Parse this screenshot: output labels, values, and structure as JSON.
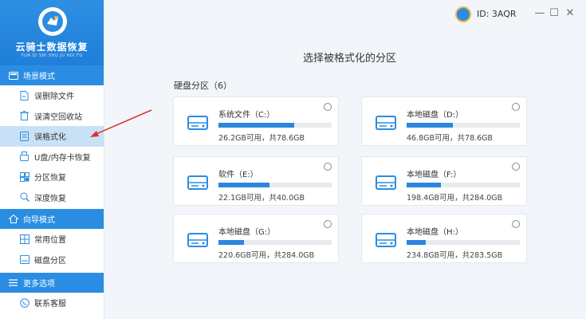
{
  "app": {
    "name": "云骑士数据恢复",
    "subtitle": "YUN QI SHI SHU JU HUI FU"
  },
  "titlebar": {
    "user_id": "ID: 3AQR",
    "minimize": "—",
    "maximize": "☐",
    "close": "✕"
  },
  "sidebar": {
    "scene_header": "场景模式",
    "scene_items": [
      {
        "label": "误删除文件",
        "icon": "file-delete-icon"
      },
      {
        "label": "误清空回收站",
        "icon": "recycle-bin-icon"
      },
      {
        "label": "误格式化",
        "icon": "format-icon",
        "active": true
      },
      {
        "label": "U盘/内存卡恢复",
        "icon": "usb-icon"
      },
      {
        "label": "分区恢复",
        "icon": "partition-icon"
      },
      {
        "label": "深度恢复",
        "icon": "deep-scan-icon"
      }
    ],
    "wizard_header": "向导模式",
    "wizard_items": [
      {
        "label": "常用位置",
        "icon": "location-icon"
      },
      {
        "label": "磁盘分区",
        "icon": "disk-partition-icon"
      }
    ],
    "more_header": "更多选项",
    "more_items": [
      {
        "label": "联系客服",
        "icon": "support-icon"
      }
    ]
  },
  "main": {
    "title": "选择被格式化的分区",
    "section_title": "硬盘分区（6）",
    "disks": [
      {
        "name": "系统文件（C:）",
        "size": "26.2GB可用，共78.6GB",
        "used_fraction": 0.667
      },
      {
        "name": "本地磁盘（D:）",
        "size": "46.8GB可用，共78.6GB",
        "used_fraction": 0.405
      },
      {
        "name": "软件（E:）",
        "size": "22.1GB可用，共40.0GB",
        "used_fraction": 0.448
      },
      {
        "name": "本地磁盘（F:）",
        "size": "198.4GB可用，共284.0GB",
        "used_fraction": 0.301
      },
      {
        "name": "本地磁盘（G:）",
        "size": "220.6GB可用，共284.0GB",
        "used_fraction": 0.223
      },
      {
        "name": "本地磁盘（H:）",
        "size": "234.8GB可用，共283.5GB",
        "used_fraction": 0.172
      }
    ]
  },
  "colors": {
    "accent": "#2a8de3",
    "bar_fill": "#2b86de",
    "annotation_arrow": "#d9342b"
  }
}
